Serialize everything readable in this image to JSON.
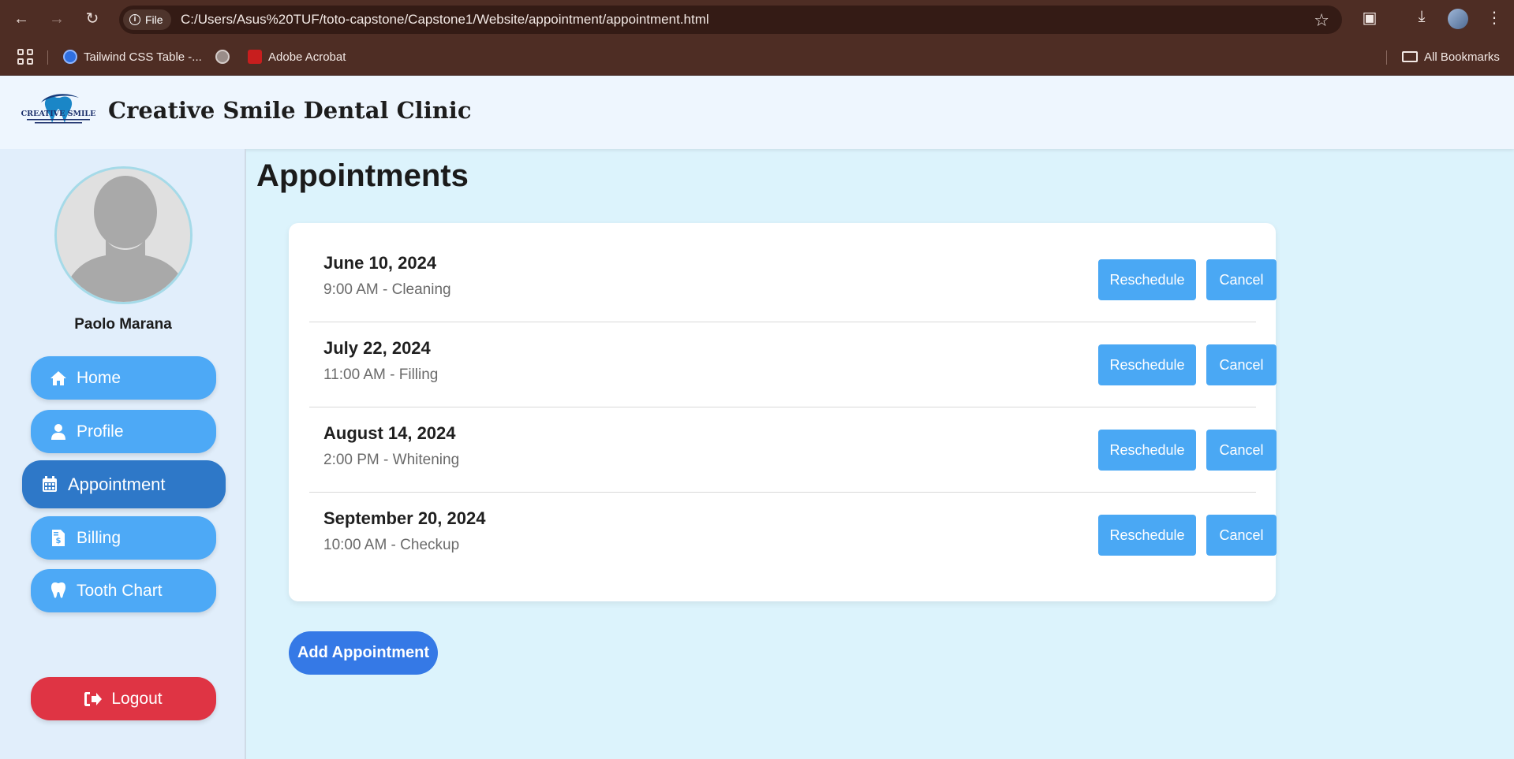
{
  "browser": {
    "file_chip": "File",
    "url": "C:/Users/Asus%20TUF/toto-capstone/Capstone1/Website/appointment/appointment.html",
    "bookmarks": [
      {
        "label": "Tailwind CSS Table -..."
      },
      {
        "label": ""
      },
      {
        "label": "Adobe Acrobat"
      }
    ],
    "all_bookmarks": "All Bookmarks"
  },
  "header": {
    "clinic_name": "Creative Smile Dental Clinic",
    "logo_text": "CREATIVE SMILE"
  },
  "sidebar": {
    "user_name": "Paolo Marana",
    "items": [
      {
        "label": "Home",
        "icon": "home-icon"
      },
      {
        "label": "Profile",
        "icon": "user-icon"
      },
      {
        "label": "Appointment",
        "icon": "calendar-icon"
      },
      {
        "label": "Billing",
        "icon": "invoice-icon"
      },
      {
        "label": "Tooth Chart",
        "icon": "tooth-icon"
      }
    ],
    "logout_label": "Logout"
  },
  "main": {
    "title": "Appointments",
    "appointments": [
      {
        "date": "June 10, 2024",
        "detail": "9:00 AM - Cleaning",
        "reschedule": "Reschedule",
        "cancel": "Cancel"
      },
      {
        "date": "July 22, 2024",
        "detail": "11:00 AM - Filling",
        "reschedule": "Reschedule",
        "cancel": "Cancel"
      },
      {
        "date": "August 14, 2024",
        "detail": "2:00 PM - Whitening",
        "reschedule": "Reschedule",
        "cancel": "Cancel"
      },
      {
        "date": "September 20, 2024",
        "detail": "10:00 AM - Checkup",
        "reschedule": "Reschedule",
        "cancel": "Cancel"
      }
    ],
    "add_label": "Add Appointment"
  },
  "colors": {
    "page_bg": "#dcf3fc",
    "sidebar_btn": "#4da9f6",
    "sidebar_active": "#2e78c8",
    "logout": "#df3444",
    "action_btn": "#4aa8f4",
    "add_btn": "#3579e6"
  }
}
